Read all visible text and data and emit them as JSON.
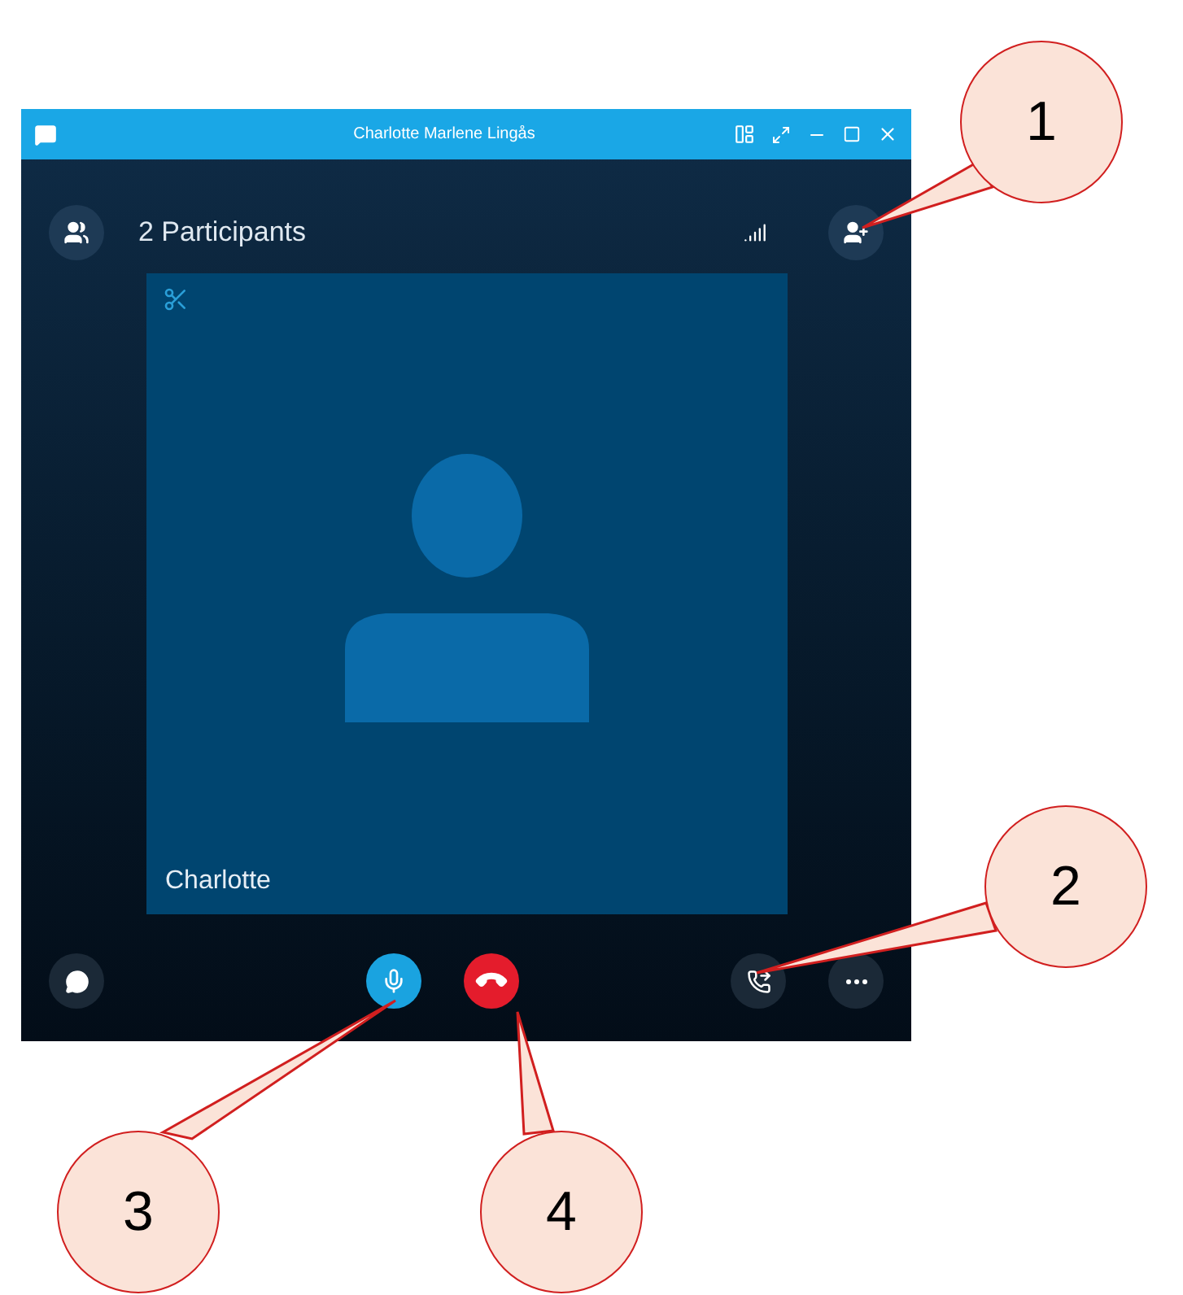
{
  "window": {
    "title": "Charlotte Marlene Lingås"
  },
  "header": {
    "participants": "2 Participants"
  },
  "tile": {
    "name": "Charlotte"
  },
  "callouts": [
    {
      "number": "1"
    },
    {
      "number": "2"
    },
    {
      "number": "3"
    },
    {
      "number": "4"
    }
  ]
}
